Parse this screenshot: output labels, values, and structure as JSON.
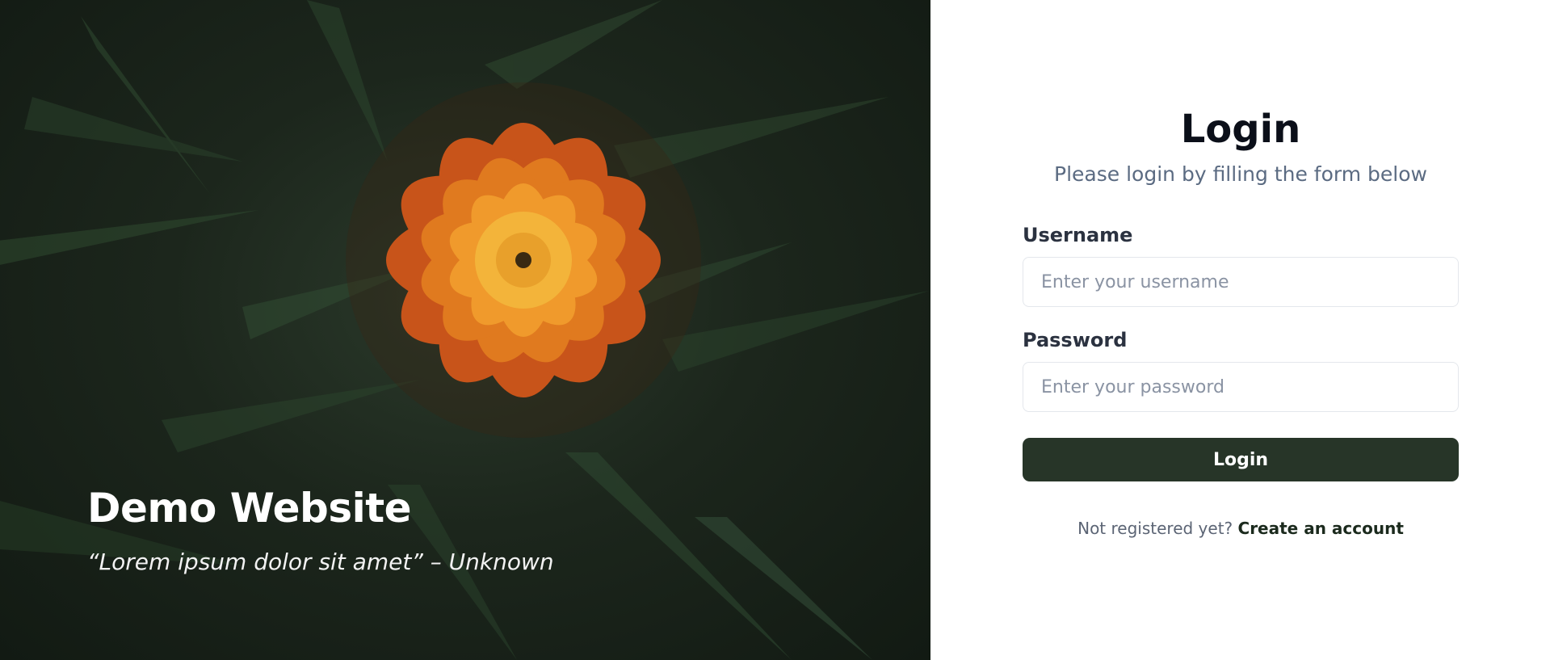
{
  "hero": {
    "title": "Demo Website",
    "quote": "“Lorem ipsum dolor sit amet” – Unknown",
    "image_subject": "orange-marigold-flower-on-dark-foliage"
  },
  "form": {
    "title": "Login",
    "subtitle": "Please login by filling the form below",
    "username_label": "Username",
    "username_placeholder": "Enter your username",
    "username_value": "",
    "password_label": "Password",
    "password_placeholder": "Enter your password",
    "password_value": "",
    "submit_label": "Login",
    "register_prompt": "Not registered yet?",
    "register_link": "Create an account"
  },
  "colors": {
    "button_bg": "#273528",
    "title_text": "#0b0f19",
    "subtitle_text": "#5b6b82",
    "hero_bg": "#1c261c",
    "flower": "#e07a1f"
  }
}
